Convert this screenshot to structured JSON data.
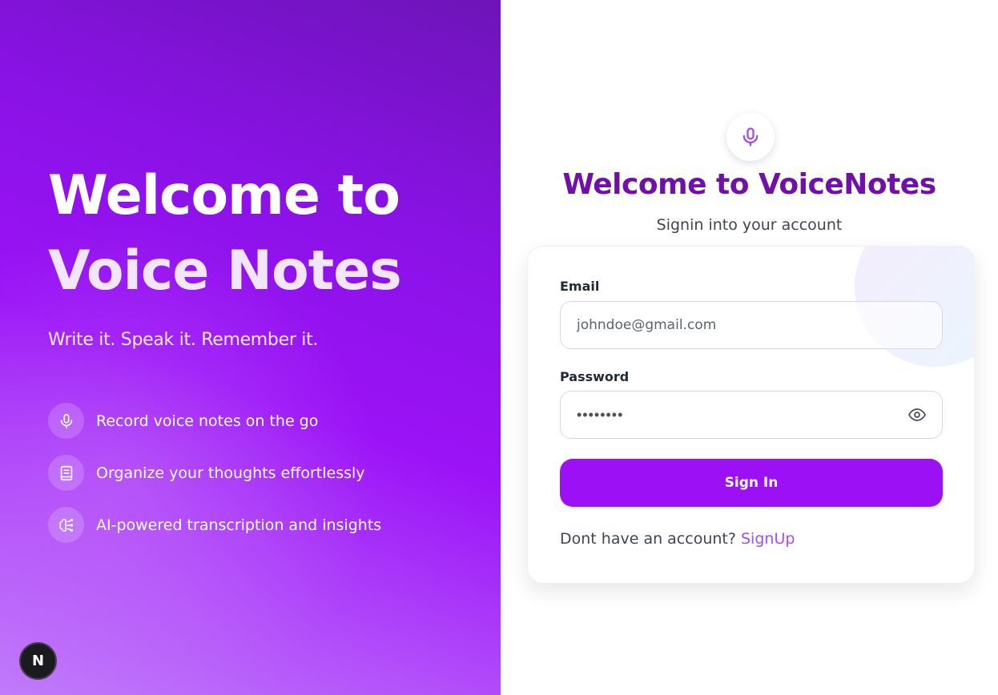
{
  "hero": {
    "title_line1": "Welcome to",
    "title_line2": "Voice Notes",
    "tagline": "Write it. Speak it. Remember it.",
    "features": [
      {
        "icon": "microphone-icon",
        "text": "Record voice notes on the go"
      },
      {
        "icon": "notebook-icon",
        "text": "Organize your thoughts effortlessly"
      },
      {
        "icon": "brain-icon",
        "text": "AI-powered transcription and insights"
      }
    ]
  },
  "badge": {
    "label": "N"
  },
  "form": {
    "brand_icon": "microphone-icon",
    "title": "Welcome to VoiceNotes",
    "subtitle": "Signin into your account",
    "email_label": "Email",
    "email_placeholder": "johndoe@gmail.com",
    "password_label": "Password",
    "password_value": "••••••••",
    "password_toggle_icon": "eye-icon",
    "submit_label": "Sign In",
    "signup_prompt": "Dont have an account?",
    "signup_link": "SignUp"
  },
  "colors": {
    "accent": "#9b10f5",
    "title": "#7010a8",
    "link": "#a64bf2"
  }
}
